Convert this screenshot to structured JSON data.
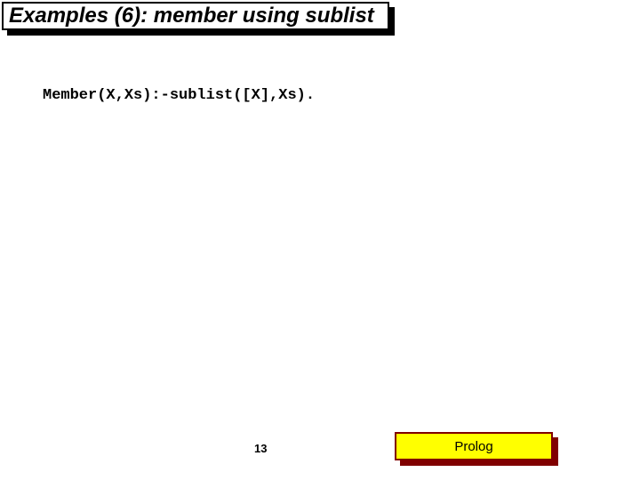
{
  "slide": {
    "title": "Examples (6): member using sublist",
    "code_line": "Member(X,Xs):-sublist([X],Xs).",
    "page_number": "13",
    "badge_label": "Prolog"
  }
}
